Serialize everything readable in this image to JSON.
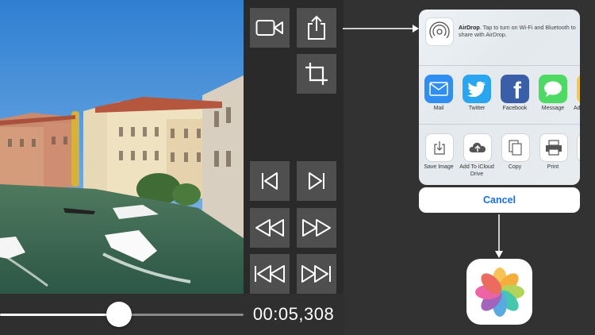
{
  "player": {
    "timecode": "00:05,308",
    "progress_fraction": 0.505
  },
  "controls": {
    "record_icon": "video-camera-icon",
    "share_icon": "share-icon",
    "crop_icon": "crop-icon",
    "prev_frame_icon": "step-backward-icon",
    "next_frame_icon": "step-forward-icon",
    "rewind_icon": "rewind-icon",
    "fast_forward_icon": "fast-forward-icon",
    "skip_start_icon": "skip-to-start-icon",
    "skip_end_icon": "skip-to-end-icon"
  },
  "share_sheet": {
    "airdrop_title": "AirDrop",
    "airdrop_text": ". Tap to turn on Wi-Fi and Bluetooth to share with AirDrop.",
    "apps": [
      {
        "label": "Mail",
        "color": "#2f8ef0"
      },
      {
        "label": "Twitter",
        "color": "#2aa5f0"
      },
      {
        "label": "Facebook",
        "color": "#3b5ea8"
      },
      {
        "label": "Message",
        "color": "#4cd964"
      },
      {
        "label": "Ad"
      }
    ],
    "actions": [
      {
        "label": "Save Image"
      },
      {
        "label": "Add To iCloud Drive"
      },
      {
        "label": "Copy"
      },
      {
        "label": "Print"
      }
    ],
    "cancel_label": "Cancel"
  },
  "colors": {
    "background": "#2f2f2f",
    "control_button": "#4f4f4f",
    "cancel_text": "#1a6fe0"
  }
}
